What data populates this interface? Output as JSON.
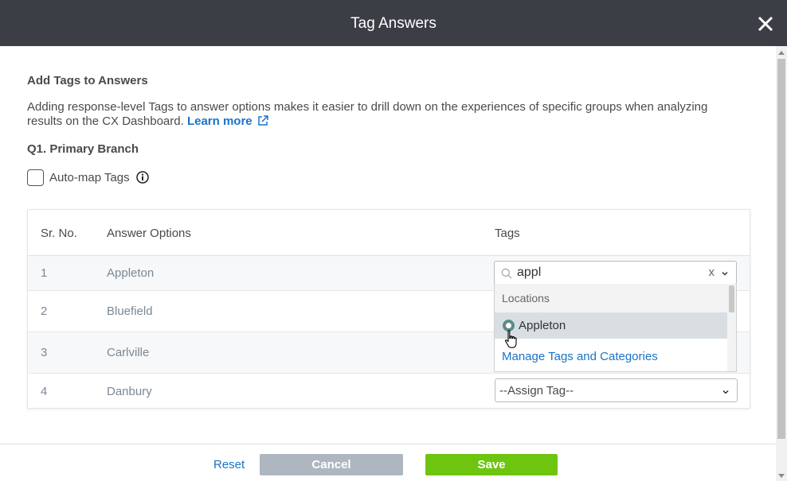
{
  "dialog": {
    "title": "Tag Answers",
    "close_icon": "close-icon"
  },
  "section": {
    "title": "Add Tags to Answers",
    "description": "Adding response-level Tags to answer options makes it easier to drill down on the experiences of specific groups when analyzing results on the CX Dashboard.",
    "learn_more": "Learn more",
    "external_icon": "external-link-icon"
  },
  "question": {
    "title": "Q1. Primary Branch"
  },
  "automap": {
    "label": "Auto-map Tags",
    "checked": false,
    "info_icon": "info-icon"
  },
  "table": {
    "headers": {
      "sr": "Sr. No.",
      "answer": "Answer Options",
      "tags": "Tags"
    },
    "rows": [
      {
        "sr": "1",
        "answer": "Appleton"
      },
      {
        "sr": "2",
        "answer": "Bluefield"
      },
      {
        "sr": "3",
        "answer": "Carlville"
      },
      {
        "sr": "4",
        "answer": "Danbury",
        "tag": "--Assign Tag--"
      }
    ]
  },
  "tag_search": {
    "value": "appl",
    "clear": "x",
    "search_icon": "search-icon"
  },
  "dropdown": {
    "group_label": "Locations",
    "options": [
      {
        "label": "Appleton",
        "selected": true
      }
    ],
    "manage_link": "Manage Tags and Categories"
  },
  "footer": {
    "reset": "Reset",
    "cancel": "Cancel",
    "save": "Save"
  },
  "colors": {
    "header_bg": "#3b3f45",
    "link": "#1a73c9",
    "save": "#6ec50f",
    "cancel": "#aeb7bf"
  }
}
